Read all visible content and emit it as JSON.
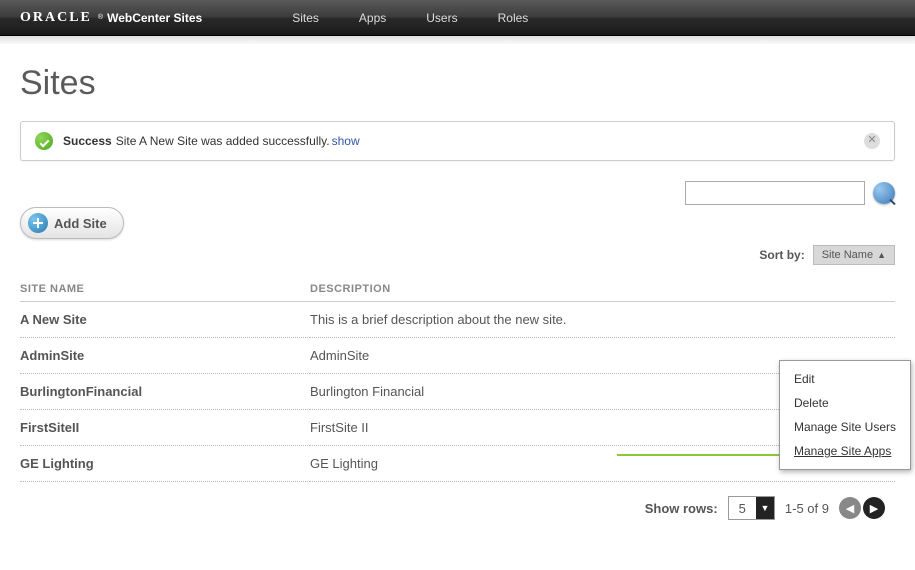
{
  "brand": {
    "name": "ORACLE",
    "product": "WebCenter Sites"
  },
  "topnav": [
    "Sites",
    "Apps",
    "Users",
    "Roles"
  ],
  "page": {
    "title": "Sites"
  },
  "message": {
    "label": "Success",
    "text": "Site A New Site was added successfully.",
    "link": "show"
  },
  "toolbar": {
    "add_label": "Add Site"
  },
  "search": {
    "value": ""
  },
  "sort": {
    "label": "Sort by:",
    "current": "Site Name"
  },
  "table": {
    "headers": [
      "SITE NAME",
      "DESCRIPTION"
    ],
    "rows": [
      {
        "name": "A New Site",
        "desc": "This is a brief description about the new site."
      },
      {
        "name": "AdminSite",
        "desc": "AdminSite"
      },
      {
        "name": "BurlingtonFinancial",
        "desc": "Burlington Financial"
      },
      {
        "name": "FirstSiteII",
        "desc": "FirstSite II"
      },
      {
        "name": "GE Lighting",
        "desc": "GE Lighting"
      }
    ]
  },
  "contextMenu": [
    "Edit",
    "Delete",
    "Manage Site Users",
    "Manage Site Apps"
  ],
  "pager": {
    "label": "Show rows:",
    "rows": "5",
    "range": "1-5 of 9"
  }
}
